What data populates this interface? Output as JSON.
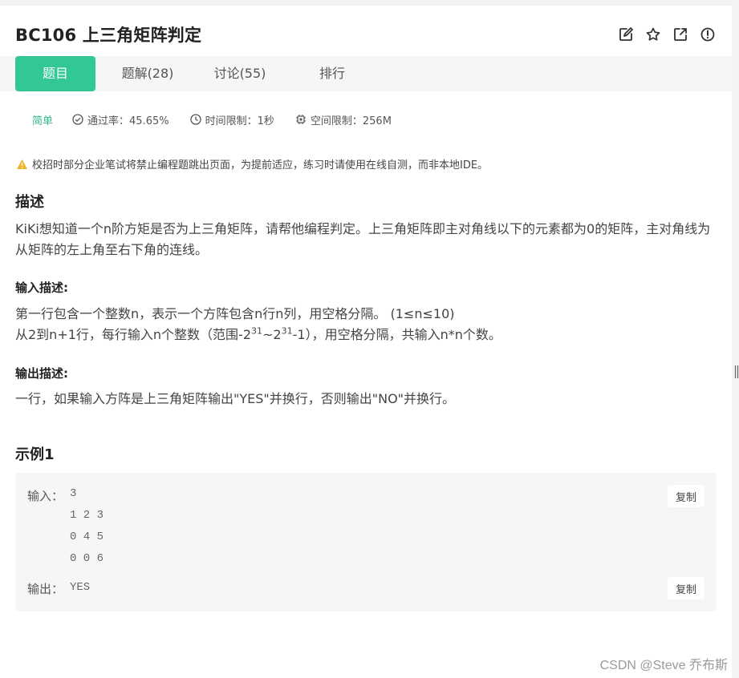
{
  "problem": {
    "title": "BC106  上三角矩阵判定"
  },
  "tabs": [
    {
      "label": "题目",
      "active": true
    },
    {
      "label": "题解(28)"
    },
    {
      "label": "讨论(55)"
    },
    {
      "label": "排行"
    }
  ],
  "meta": {
    "difficulty": "简单",
    "pass_rate": "通过率：45.65%",
    "time_limit": "时间限制：1秒",
    "space_limit": "空间限制：256M"
  },
  "notice": "校招时部分企业笔试将禁止编程题跳出页面，为提前适应，练习时请使用在线自测，而非本地IDE。",
  "description": {
    "heading": "描述",
    "text": "KiKi想知道一个n阶方矩是否为上三角矩阵，请帮他编程判定。上三角矩阵即主对角线以下的元素都为0的矩阵，主对角线为从矩阵的左上角至右下角的连线。"
  },
  "input_desc": {
    "heading": "输入描述:",
    "line1": "第一行包含一个整数n，表示一个方阵包含n行n列，用空格分隔。 (1≤n≤10)",
    "line2_pre": "从2到n+1行，每行输入n个整数（范围-2",
    "line2_sup1": "31",
    "line2_mid": "~2",
    "line2_sup2": "31",
    "line2_post": "-1），用空格分隔，共输入n*n个数。"
  },
  "output_desc": {
    "heading": "输出描述:",
    "text": "一行，如果输入方阵是上三角矩阵输出\"YES\"并换行，否则输出\"NO\"并换行。"
  },
  "example": {
    "heading": "示例1",
    "input_label": "输入：",
    "input_lines": [
      "3",
      "1 2 3",
      "0 4 5",
      "0 0 6"
    ],
    "output_label": "输出：",
    "output_value": "YES",
    "copy_label": "复制"
  },
  "watermark": "CSDN @Steve 乔布斯",
  "icons": {
    "edit": "edit-icon",
    "star": "star-icon",
    "share": "external-link-icon",
    "report": "info-icon",
    "check": "check-circle-icon",
    "clock": "clock-icon",
    "chip": "chip-icon",
    "warning": "warning-icon"
  },
  "colors": {
    "accent": "#32c896",
    "difficulty": "#32b88a",
    "warning": "#f0b429"
  }
}
